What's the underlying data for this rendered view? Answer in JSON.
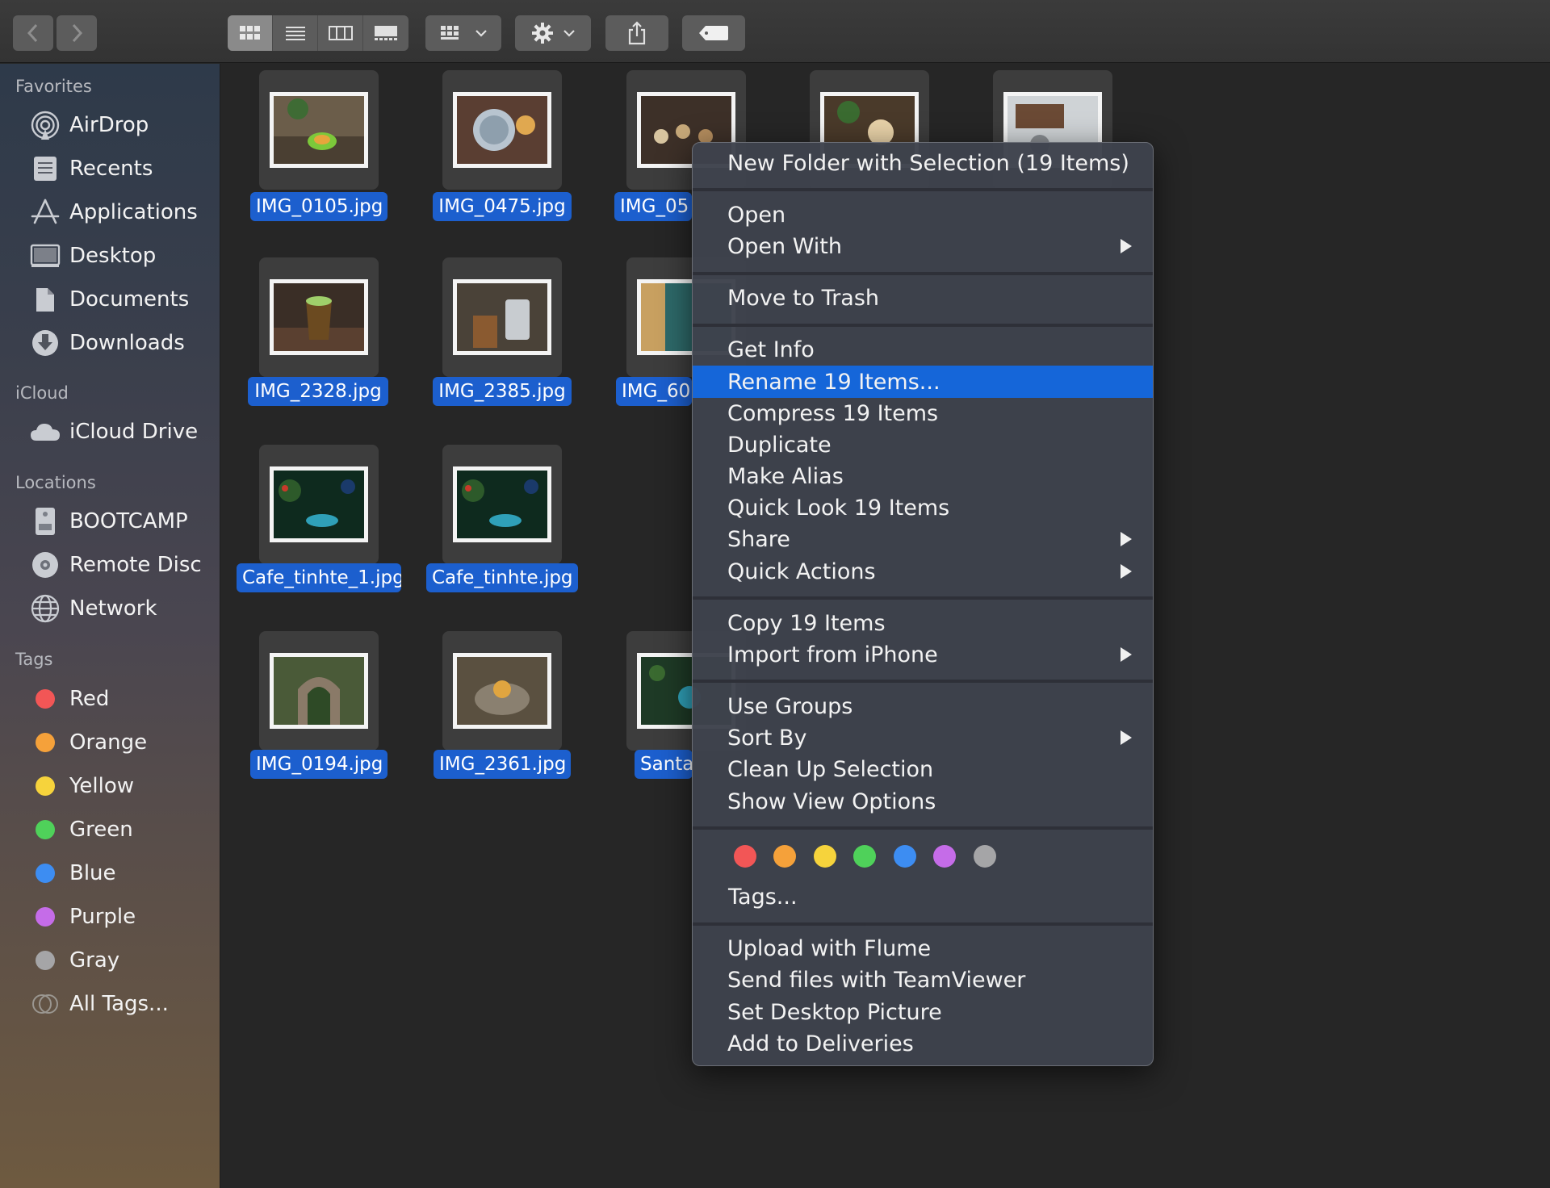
{
  "toolbar": {
    "back": "back-icon",
    "forward": "forward-icon",
    "view_modes": [
      "icon-view",
      "list-view",
      "column-view",
      "gallery-view"
    ],
    "active_view": "icon-view",
    "group": "group-icon",
    "action": "gear-icon",
    "share": "share-icon",
    "tag": "tag-icon"
  },
  "sidebar": {
    "favorites_header": "Favorites",
    "favorites": [
      {
        "label": "AirDrop",
        "icon": "airdrop-icon"
      },
      {
        "label": "Recents",
        "icon": "recents-icon"
      },
      {
        "label": "Applications",
        "icon": "applications-icon"
      },
      {
        "label": "Desktop",
        "icon": "desktop-icon"
      },
      {
        "label": "Documents",
        "icon": "documents-icon"
      },
      {
        "label": "Downloads",
        "icon": "downloads-icon"
      }
    ],
    "icloud_header": "iCloud",
    "icloud": [
      {
        "label": "iCloud Drive",
        "icon": "cloud-icon"
      }
    ],
    "locations_header": "Locations",
    "locations": [
      {
        "label": "BOOTCAMP",
        "icon": "disk-icon"
      },
      {
        "label": "Remote Disc",
        "icon": "disc-icon"
      },
      {
        "label": "Network",
        "icon": "network-icon"
      }
    ],
    "tags_header": "Tags",
    "tags": [
      {
        "label": "Red",
        "color": "#f25656"
      },
      {
        "label": "Orange",
        "color": "#f5a13a"
      },
      {
        "label": "Yellow",
        "color": "#f6d33c"
      },
      {
        "label": "Green",
        "color": "#4fd15a"
      },
      {
        "label": "Blue",
        "color": "#3d8df2"
      },
      {
        "label": "Purple",
        "color": "#c56ce8"
      },
      {
        "label": "Gray",
        "color": "#a5a5a7"
      },
      {
        "label": "All Tags...",
        "color": ""
      }
    ]
  },
  "files": [
    {
      "name": "IMG_0105.jpg"
    },
    {
      "name": "IMG_0475.jpg"
    },
    {
      "name": "IMG_05"
    },
    {
      "name": ""
    },
    {
      "name": ""
    },
    {
      "name": "IMG_2328.jpg"
    },
    {
      "name": "IMG_2385.jpg"
    },
    {
      "name": "IMG_60"
    },
    {
      "name": "Cafe_tinhte_1.jpg"
    },
    {
      "name": "Cafe_tinhte.jpg"
    },
    {
      "name": "IMG_0194.jpg"
    },
    {
      "name": "IMG_2361.jpg"
    },
    {
      "name": "Santa"
    }
  ],
  "context_menu": {
    "new_folder": "New Folder with Selection (19 Items)",
    "open": "Open",
    "open_with": "Open With",
    "move_to_trash": "Move to Trash",
    "get_info": "Get Info",
    "rename": "Rename 19 Items...",
    "compress": "Compress 19 Items",
    "duplicate": "Duplicate",
    "make_alias": "Make Alias",
    "quick_look": "Quick Look 19 Items",
    "share": "Share",
    "quick_actions": "Quick Actions",
    "copy": "Copy 19 Items",
    "import_iphone": "Import from iPhone",
    "use_groups": "Use Groups",
    "sort_by": "Sort By",
    "clean_up": "Clean Up Selection",
    "show_view_options": "Show View Options",
    "tag_colors": [
      "#f25656",
      "#f5a13a",
      "#f6d33c",
      "#4fd15a",
      "#3d8df2",
      "#c56ce8",
      "#a5a5a7"
    ],
    "tags": "Tags...",
    "upload_flume": "Upload with Flume",
    "send_teamviewer": "Send files with TeamViewer",
    "set_desktop": "Set Desktop Picture",
    "add_deliveries": "Add to Deliveries",
    "highlighted": "Rename 19 Items..."
  }
}
